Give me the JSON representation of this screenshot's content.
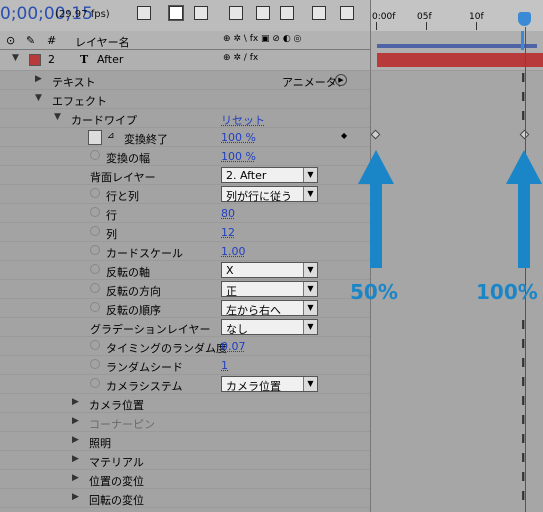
{
  "header": {
    "timecode": "0;00;00;15",
    "fps": "(29.97 fps)",
    "ruler_labels": [
      "0:00f",
      "05f",
      "10f"
    ]
  },
  "columns": {
    "num": "#",
    "layer_name": "レイヤー名",
    "switches": "⊕ ✲ \\ fx ▣ ⊘ ◐ ◎"
  },
  "layer": {
    "number": "2",
    "type_icon": "T",
    "name": "After",
    "switch_text": "⊕ ✲ / fx"
  },
  "rows": {
    "text_group": "テキスト",
    "animator": "アニメータ：",
    "effects_group": "エフェクト",
    "card_wipe": "カードワイプ",
    "reset": "リセット",
    "transition_completion": {
      "label": "変換終了",
      "value": "100 %"
    },
    "transition_width": {
      "label": "変換の幅",
      "value": "100 %"
    },
    "back_layer": {
      "label": "背面レイヤー",
      "value": "2. After"
    },
    "rows_columns": {
      "label": "行と列",
      "value": "列が行に従う"
    },
    "rows": {
      "label": "行",
      "value": "80"
    },
    "columns": {
      "label": "列",
      "value": "12"
    },
    "card_scale": {
      "label": "カードスケール",
      "value": "1.00"
    },
    "flip_axis": {
      "label": "反転の軸",
      "value": "X"
    },
    "flip_direction": {
      "label": "反転の方向",
      "value": "正"
    },
    "flip_order": {
      "label": "反転の順序",
      "value": "左から右へ"
    },
    "gradient_layer": {
      "label": "グラデーションレイヤー",
      "value": "なし"
    },
    "timing_randomness": {
      "label": "タイミングのランダム度",
      "value": "0.07"
    },
    "random_seed": {
      "label": "ランダムシード",
      "value": "1"
    },
    "camera_system": {
      "label": "カメラシステム",
      "value": "カメラ位置"
    },
    "camera_position": "カメラ位置",
    "corner_pins": "コーナーピン",
    "lighting": "照明",
    "material": "マテリアル",
    "position_jitter": "位置の変位",
    "rotation_jitter": "回転の変位"
  },
  "annotations": {
    "left": "50%",
    "right": "100%"
  },
  "colors": {
    "accent_blue": "#1a86c8",
    "layer_red": "#b83a3a",
    "timecode_blue": "#2a4fb0"
  }
}
